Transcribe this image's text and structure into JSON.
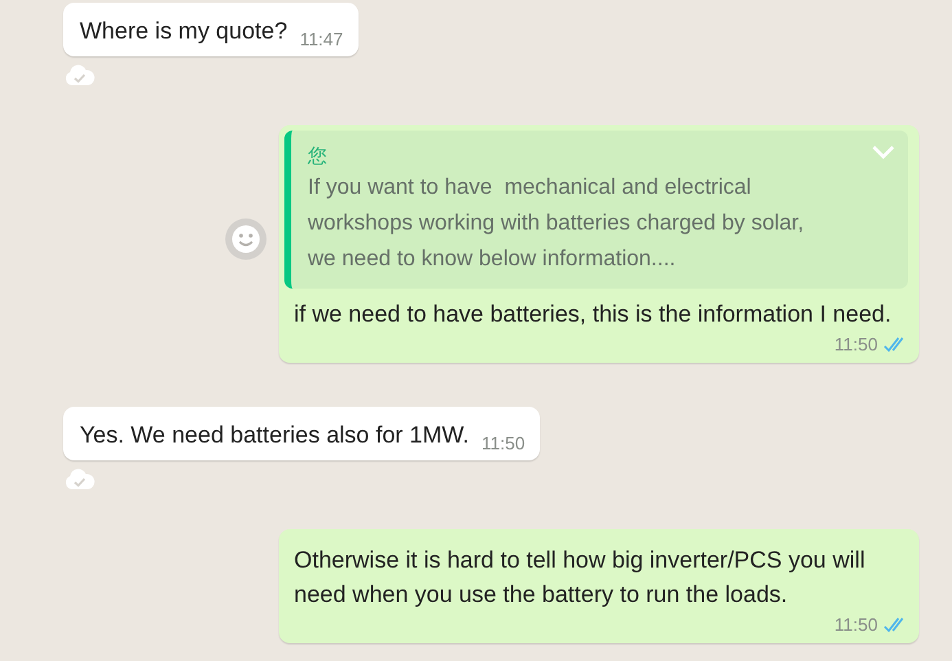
{
  "messages": [
    {
      "kind": "incoming",
      "text": "Where is my quote?",
      "time": "11:47"
    },
    {
      "kind": "outgoing",
      "quote": {
        "author": "您",
        "text": "If you want to have  mechanical and electrical workshops working with batteries charged by solar, we need to know below information...."
      },
      "text": "if we need to have batteries, this is the information I need.",
      "time": "11:50",
      "read": true
    },
    {
      "kind": "incoming",
      "text": "Yes. We need batteries also for 1MW.",
      "time": "11:50"
    },
    {
      "kind": "outgoing",
      "text": "Otherwise it is hard to tell how big inverter/PCS you will need when you use the battery to run the loads.",
      "time": "11:50",
      "read": true
    }
  ]
}
